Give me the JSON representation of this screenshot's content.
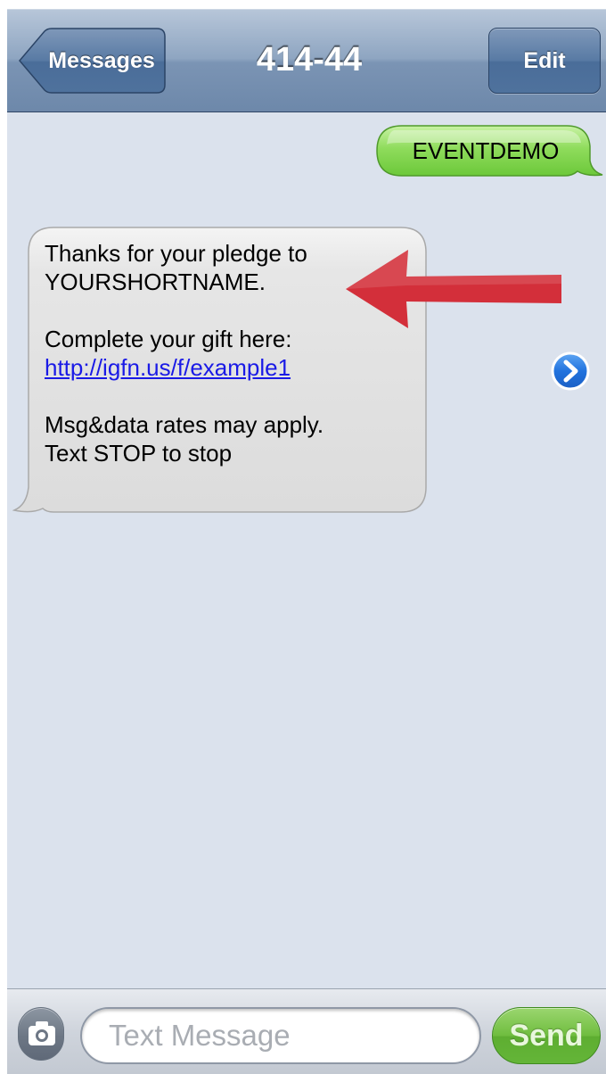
{
  "navbar": {
    "back_label": "Messages",
    "title": "414-44",
    "edit_label": "Edit"
  },
  "conversation": {
    "sent": [
      {
        "text": "EVENTDEMO"
      }
    ],
    "received": [
      {
        "line1": "Thanks for your pledge to",
        "line2": "YOURSHORTNAME.",
        "line3": "Complete your gift here:",
        "link": "http://igfn.us/f/example1",
        "line4": "Msg&data rates may apply.",
        "line5": "Text STOP to stop"
      }
    ]
  },
  "annotation": {
    "arrow_color": "#d32f3a"
  },
  "input_bar": {
    "placeholder": "Text Message",
    "send_label": "Send"
  },
  "icons": {
    "back": "chevron-left-icon",
    "disclosure": "chevron-right-circle-icon",
    "camera": "camera-icon"
  },
  "colors": {
    "navbar": "#7b94b4",
    "background": "#dbe2ed",
    "sent_bubble": "#7ed34e",
    "received_bubble": "#e5e5e5",
    "link": "#1a1ae6",
    "send_button": "#64b538"
  }
}
